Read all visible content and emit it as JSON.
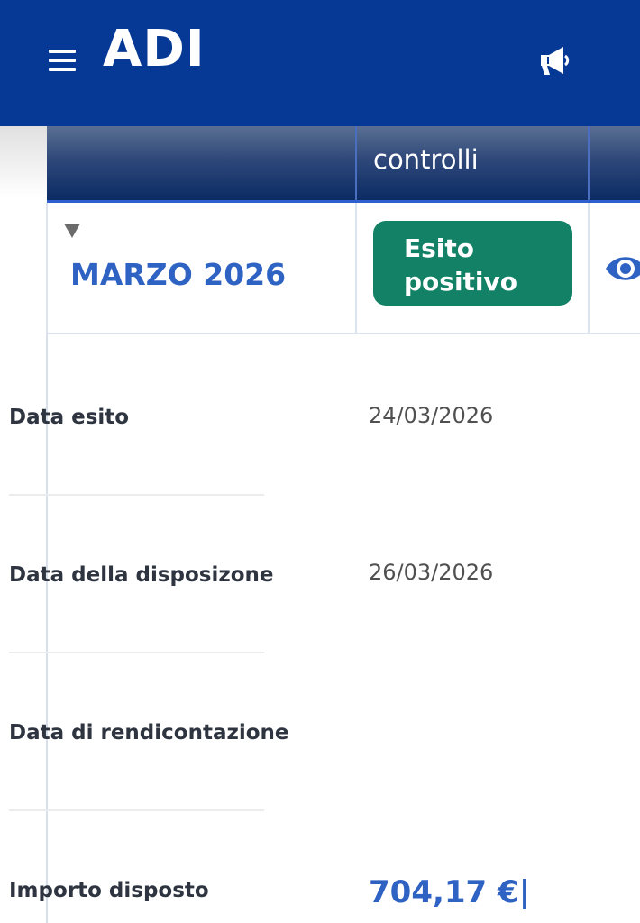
{
  "appbar": {
    "menu_icon": "hamburger-menu-icon",
    "title": "ADI",
    "action_icon": "megaphone-icon",
    "color": "#063996"
  },
  "table": {
    "columns": [
      "",
      "controlli",
      ""
    ],
    "row": {
      "expand_icon": "caret-down-icon",
      "month": "MARZO 2026",
      "badge": "Esito positivo",
      "badge_color": "#138165",
      "view_icon": "eye-icon"
    }
  },
  "details": [
    {
      "label": "Data esito",
      "value": "24/03/2026"
    },
    {
      "label": "Data della disposizone",
      "value": "26/03/2026"
    },
    {
      "label": "Data di rendicontazione",
      "value": ""
    },
    {
      "label": "Importo disposto",
      "value": "704,17 €|"
    }
  ],
  "colors": {
    "accent": "#2e62c3",
    "header_dark": "#0a2a64"
  }
}
